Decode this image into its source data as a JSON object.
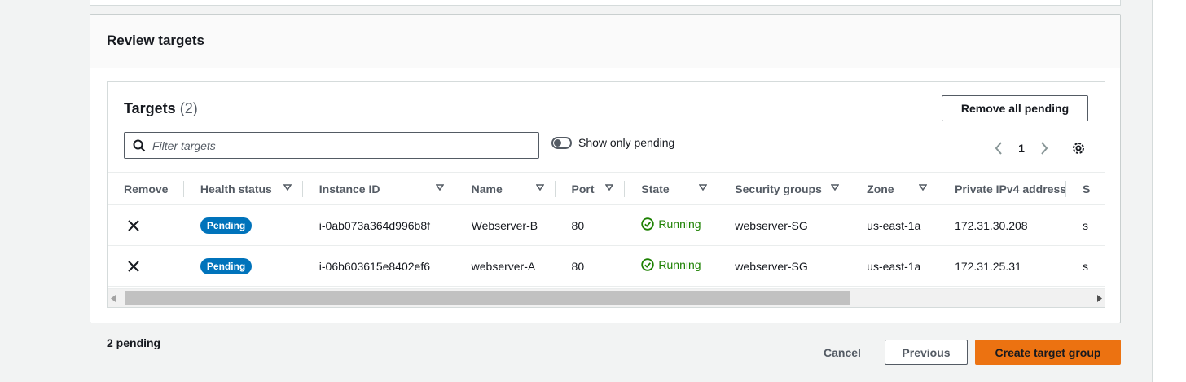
{
  "panel": {
    "title": "Review targets"
  },
  "targets": {
    "title": "Targets",
    "count": "(2)",
    "remove_all_label": "Remove all pending",
    "filter_placeholder": "Filter targets",
    "toggle_label": "Show only pending",
    "page": "1"
  },
  "columns": [
    "Remove",
    "Health status",
    "Instance ID",
    "Name",
    "Port",
    "State",
    "Security groups",
    "Zone",
    "Private IPv4 address",
    "S"
  ],
  "rows": [
    {
      "health": "Pending",
      "instance_id": "i-0ab073a364d996b8f",
      "name": "Webserver-B",
      "port": "80",
      "state": "Running",
      "security_group": "webserver-SG",
      "zone": "us-east-1a",
      "ip": "172.31.30.208",
      "extra": "s"
    },
    {
      "health": "Pending",
      "instance_id": "i-06b603615e8402ef6",
      "name": "webserver-A",
      "port": "80",
      "state": "Running",
      "security_group": "webserver-SG",
      "zone": "us-east-1a",
      "ip": "172.31.25.31",
      "extra": "s"
    }
  ],
  "footer": {
    "pending_text": "2 pending",
    "cancel_label": "Cancel",
    "previous_label": "Previous",
    "create_label": "Create target group"
  },
  "colors": {
    "badge": "#0073bb",
    "running": "#1d8102",
    "primary_button": "#ec7211"
  },
  "icons": [
    "search-icon",
    "chevron-left-icon",
    "chevron-right-icon",
    "gear-icon",
    "sort-down-icon",
    "close-icon",
    "check-circle-icon"
  ]
}
